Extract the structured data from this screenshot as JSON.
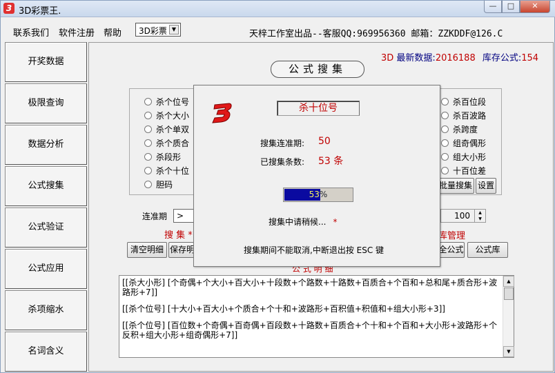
{
  "window": {
    "title": "3D彩票王.",
    "min_label": "—",
    "max_label": "□",
    "close_label": "✕"
  },
  "menu": {
    "items": [
      "联系我们",
      "软件注册",
      "帮助"
    ],
    "lottery_select": "3D彩票",
    "credit": "天梓工作室出品--客服QQ:969956360 邮箱：ZZKDDF@126.C"
  },
  "sidebar": {
    "items": [
      "开奖数据",
      "极限查询",
      "数据分析",
      "公式搜集",
      "公式验证",
      "公式应用",
      "杀项缩水",
      "名词含义"
    ]
  },
  "status": {
    "prefix": "3D",
    "latest_label": "最新数据:",
    "latest_value": "2016188",
    "stock_label": "库存公式:",
    "stock_value": "154"
  },
  "main": {
    "section_title": "公式搜集",
    "radios_left": [
      "杀个位号",
      "杀个大小",
      "杀个单双",
      "杀个质合",
      "杀段形",
      "杀个十位",
      "胆码"
    ],
    "radios_right": [
      "杀百位段",
      "杀百波路",
      "杀跨度",
      "组奇偶形",
      "组大小形",
      "十百位差"
    ],
    "batch_button": "批量搜集",
    "settings_button": "设置",
    "lianzhun_label": "连准期",
    "lianzhun_value": ">",
    "spin_value": "100",
    "collect_header": "搜 集 *",
    "library_header": "库管理",
    "clear_button": "清空明细",
    "save_button": "保存明",
    "formula_button": "全公式",
    "library_button": "公式库",
    "detail_header": "公 式 明 细",
    "details": [
      "[[杀大小形] [个奇偶+个大小+百大小+十段数+个路数+十路数+百质合+个百和+总和尾+质合形+波路形+7]]",
      "[[杀个位号] [十大小+百大小+个质合+个十和+波路形+百积值+积值和+组大小形+3]]",
      "[[杀个位号] [百位数+个奇偶+百奇偶+百段数+十路数+百质合+个十和+个百和+大小形+波路形+个反积+组大小形+组奇偶形+7]]"
    ]
  },
  "dialog": {
    "title": "杀十位号",
    "period_label": "搜集连准期:",
    "period_value": "50",
    "count_label": "已搜集条数:",
    "count_value": "53 条",
    "progress_text": "53%",
    "progress": 0.53,
    "wait_text": "搜集中请稍候...",
    "wait_mark": "*",
    "note": "搜集期间不能取消,中断退出按 ESC 键"
  },
  "colors": {
    "accent_red": "#c00000",
    "progress_blue": "#0a0aa0",
    "stock_blue": "#000080"
  }
}
